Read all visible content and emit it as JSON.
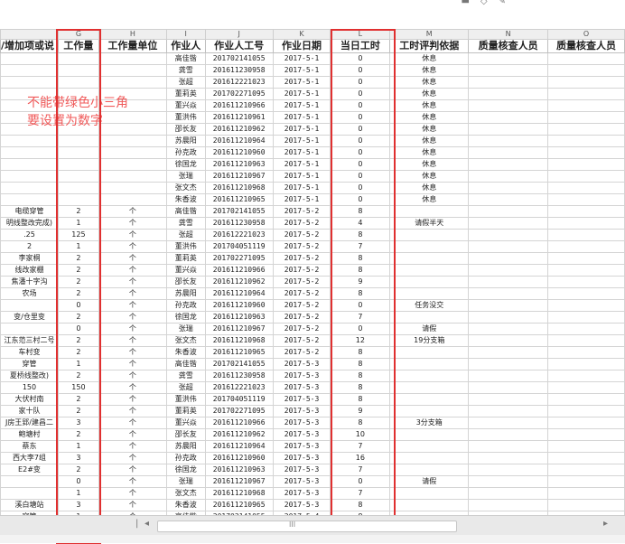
{
  "columns": [
    {
      "letter": "",
      "header": "/增加项或说",
      "width": 64
    },
    {
      "letter": "G",
      "header": "工作量",
      "width": 45
    },
    {
      "letter": "H",
      "header": "工作量单位",
      "width": 75
    },
    {
      "letter": "I",
      "header": "作业人",
      "width": 43
    },
    {
      "letter": "J",
      "header": "作业人工号",
      "width": 75
    },
    {
      "letter": "K",
      "header": "作业日期",
      "width": 64
    },
    {
      "letter": "L",
      "header": "当日工时",
      "width": 66
    },
    {
      "letter": "M",
      "header": "工时评判依据",
      "width": 87
    },
    {
      "letter": "N",
      "header": "质量核查人员",
      "width": 88
    },
    {
      "letter": "O",
      "header": "质量核查人员",
      "width": 85
    }
  ],
  "rows": [
    [
      "",
      "",
      "",
      "高佳锴",
      "201702141055",
      "2017-5-1",
      "0",
      "休息",
      "",
      ""
    ],
    [
      "",
      "",
      "",
      "龚雪",
      "201611230958",
      "2017-5-1",
      "0",
      "休息",
      "",
      ""
    ],
    [
      "",
      "",
      "",
      "张超",
      "201612221023",
      "2017-5-1",
      "0",
      "休息",
      "",
      ""
    ],
    [
      "",
      "",
      "",
      "董莉英",
      "201702271095",
      "2017-5-1",
      "0",
      "休息",
      "",
      ""
    ],
    [
      "",
      "",
      "",
      "董兴焱",
      "201611210966",
      "2017-5-1",
      "0",
      "休息",
      "",
      ""
    ],
    [
      "",
      "",
      "",
      "董洪伟",
      "201611210961",
      "2017-5-1",
      "0",
      "休息",
      "",
      ""
    ],
    [
      "",
      "",
      "",
      "邵长友",
      "201611210962",
      "2017-5-1",
      "0",
      "休息",
      "",
      ""
    ],
    [
      "",
      "",
      "",
      "苏晨阳",
      "201611210964",
      "2017-5-1",
      "0",
      "休息",
      "",
      ""
    ],
    [
      "",
      "",
      "",
      "孙克政",
      "201611210960",
      "2017-5-1",
      "0",
      "休息",
      "",
      ""
    ],
    [
      "",
      "",
      "",
      "徐国龙",
      "201611210963",
      "2017-5-1",
      "0",
      "休息",
      "",
      ""
    ],
    [
      "",
      "",
      "",
      "张瑞",
      "201611210967",
      "2017-5-1",
      "0",
      "休息",
      "",
      ""
    ],
    [
      "",
      "",
      "",
      "张文杰",
      "201611210968",
      "2017-5-1",
      "0",
      "休息",
      "",
      ""
    ],
    [
      "",
      "",
      "",
      "朱香波",
      "201611210965",
      "2017-5-1",
      "0",
      "休息",
      "",
      ""
    ],
    [
      "电缆穿管",
      "2",
      "个",
      "高佳锴",
      "201702141055",
      "2017-5-2",
      "8",
      "",
      "",
      ""
    ],
    [
      "明线整改完成)",
      "1",
      "个",
      "龚雪",
      "201611230958",
      "2017-5-2",
      "4",
      "请假半天",
      "",
      ""
    ],
    [
      ".25",
      "125",
      "个",
      "张超",
      "201612221023",
      "2017-5-2",
      "8",
      "",
      "",
      ""
    ],
    [
      "2",
      "1",
      "个",
      "董洪伟",
      "201704051119",
      "2017-5-2",
      "7",
      "",
      "",
      ""
    ],
    [
      "李家桐",
      "2",
      "个",
      "董莉英",
      "201702271095",
      "2017-5-2",
      "8",
      "",
      "",
      ""
    ],
    [
      "线改家棚",
      "2",
      "个",
      "董兴焱",
      "201611210966",
      "2017-5-2",
      "8",
      "",
      "",
      ""
    ],
    [
      "焦潘十字沟",
      "2",
      "个",
      "邵长友",
      "201611210962",
      "2017-5-2",
      "9",
      "",
      "",
      ""
    ],
    [
      "农场",
      "2",
      "个",
      "苏晨阳",
      "201611210964",
      "2017-5-2",
      "8",
      "",
      "",
      ""
    ],
    [
      "",
      "0",
      "个",
      "孙克政",
      "201611210960",
      "2017-5-2",
      "0",
      "任务没交",
      "",
      ""
    ],
    [
      "变/仓里变",
      "2",
      "个",
      "徐国龙",
      "201611210963",
      "2017-5-2",
      "7",
      "",
      "",
      ""
    ],
    [
      "",
      "0",
      "个",
      "张瑞",
      "201611210967",
      "2017-5-2",
      "0",
      "请假",
      "",
      ""
    ],
    [
      "江东范三村二号",
      "2",
      "个",
      "张文杰",
      "201611210968",
      "2017-5-2",
      "12",
      "19分支箱",
      "",
      ""
    ],
    [
      "车村变",
      "2",
      "个",
      "朱香波",
      "201611210965",
      "2017-5-2",
      "8",
      "",
      "",
      ""
    ],
    [
      "穿管",
      "1",
      "个",
      "高佳锴",
      "201702141055",
      "2017-5-3",
      "8",
      "",
      "",
      ""
    ],
    [
      "夏桥线整改)",
      "2",
      "个",
      "龚雪",
      "201611230958",
      "2017-5-3",
      "8",
      "",
      "",
      ""
    ],
    [
      "150",
      "150",
      "个",
      "张超",
      "201612221023",
      "2017-5-3",
      "8",
      "",
      "",
      ""
    ],
    [
      "大伏村南",
      "2",
      "个",
      "董洪伟",
      "201704051119",
      "2017-5-3",
      "8",
      "",
      "",
      ""
    ],
    [
      "家十队",
      "2",
      "个",
      "董莉英",
      "201702271095",
      "2017-5-3",
      "9",
      "",
      "",
      ""
    ],
    [
      "J房王郢/建昌二",
      "3",
      "个",
      "董兴焱",
      "201611210966",
      "2017-5-3",
      "8",
      "3分支箱",
      "",
      ""
    ],
    [
      "鲍塘村",
      "2",
      "个",
      "邵长友",
      "201611210962",
      "2017-5-3",
      "10",
      "",
      "",
      ""
    ],
    [
      "蔡东",
      "1",
      "个",
      "苏晨阳",
      "201611210964",
      "2017-5-3",
      "7",
      "",
      "",
      ""
    ],
    [
      "西大李7组",
      "3",
      "个",
      "孙克政",
      "201611210960",
      "2017-5-3",
      "16",
      "",
      "",
      ""
    ],
    [
      "E2#变",
      "2",
      "个",
      "徐国龙",
      "201611210963",
      "2017-5-3",
      "7",
      "",
      "",
      ""
    ],
    [
      "",
      "0",
      "个",
      "张瑞",
      "201611210967",
      "2017-5-3",
      "0",
      "请假",
      "",
      ""
    ],
    [
      "",
      "1",
      "个",
      "张文杰",
      "201611210968",
      "2017-5-3",
      "7",
      "",
      "",
      ""
    ],
    [
      "溪白塘站",
      "3",
      "个",
      "朱香波",
      "201611210965",
      "2017-5-3",
      "8",
      "",
      "",
      ""
    ],
    [
      "穿管",
      "1",
      "个",
      "高佳锴",
      "201702141055",
      "2017-5-4",
      "8",
      "",
      "",
      ""
    ]
  ],
  "red_names": [
    "高佳锴",
    "龚雪",
    "张超"
  ],
  "annotation": [
    "不能带绿色小三角",
    "要设置为数字"
  ],
  "colors": {
    "annotation": "#f05a5a",
    "highlight_box": "#e03030",
    "red_text": "#e02020"
  },
  "icons": [
    "minimize-icon",
    "restore-icon",
    "close-icon"
  ]
}
